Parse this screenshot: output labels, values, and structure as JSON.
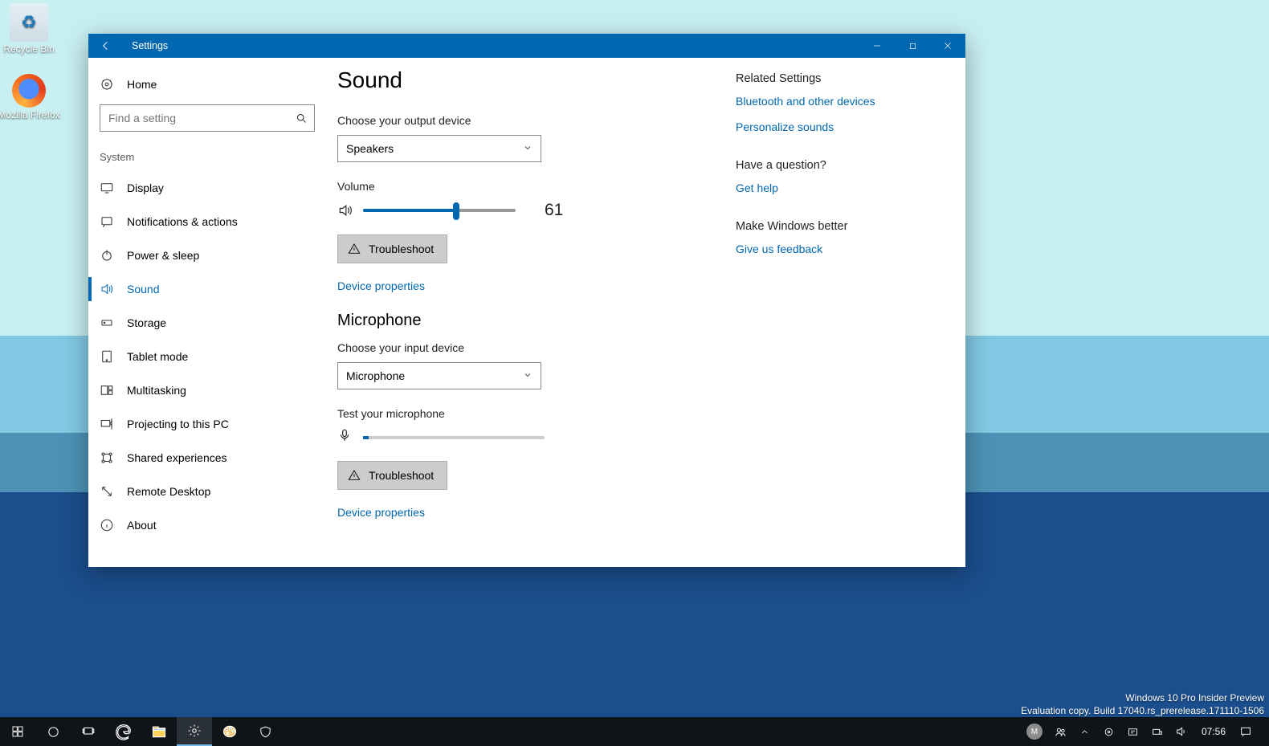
{
  "desktop": {
    "watermark_line1": "Windows 10 Pro Insider Preview",
    "watermark_line2": "Evaluation copy. Build 17040.rs_prerelease.171110-1506",
    "icons": {
      "recycle_bin": "Recycle Bin",
      "firefox": "Mozilla Firefox"
    }
  },
  "window": {
    "title": "Settings"
  },
  "sidebar": {
    "home": "Home",
    "search_placeholder": "Find a setting",
    "category": "System",
    "items": [
      "Display",
      "Notifications & actions",
      "Power & sleep",
      "Sound",
      "Storage",
      "Tablet mode",
      "Multitasking",
      "Projecting to this PC",
      "Shared experiences",
      "Remote Desktop",
      "About"
    ]
  },
  "main": {
    "heading": "Sound",
    "output_label": "Choose your output device",
    "output_selected": "Speakers",
    "volume_label": "Volume",
    "volume_value": "61",
    "volume_percent": 61,
    "troubleshoot": "Troubleshoot",
    "device_props": "Device properties",
    "mic_heading": "Microphone",
    "input_label": "Choose your input device",
    "input_selected": "Microphone",
    "mic_test_label": "Test your microphone"
  },
  "rail": {
    "related_title": "Related Settings",
    "related_links": [
      "Bluetooth and other devices",
      "Personalize sounds"
    ],
    "question_title": "Have a question?",
    "question_link": "Get help",
    "better_title": "Make Windows better",
    "better_link": "Give us feedback"
  },
  "taskbar": {
    "time": "07:56",
    "user_letter": "M"
  }
}
